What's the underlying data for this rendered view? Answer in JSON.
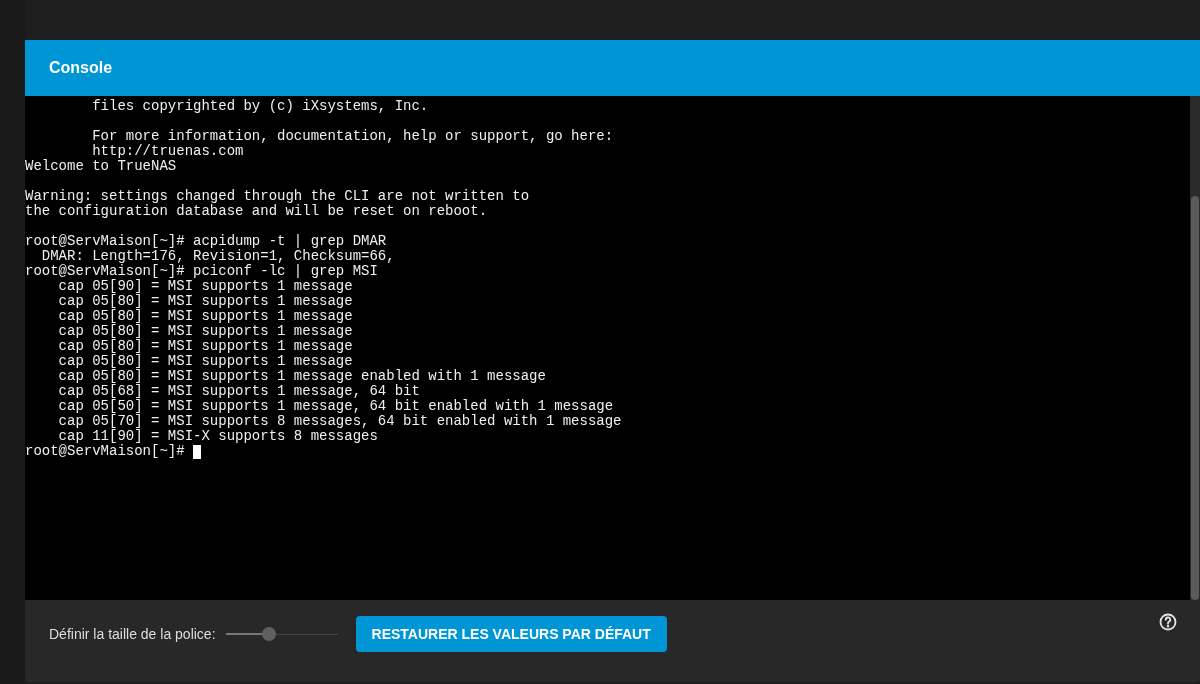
{
  "header": {
    "title": "Console"
  },
  "terminal": {
    "blocks": [
      [
        "        files copyrighted by (c) iXsystems, Inc."
      ],
      [
        "        For more information, documentation, help or support, go here:",
        "        http://truenas.com",
        "Welcome to TrueNAS"
      ],
      [
        "Warning: settings changed through the CLI are not written to",
        "the configuration database and will be reset on reboot."
      ],
      [
        "root@ServMaison[~]# acpidump -t | grep DMAR",
        "  DMAR: Length=176, Revision=1, Checksum=66,",
        "root@ServMaison[~]# pciconf -lc | grep MSI",
        "    cap 05[90] = MSI supports 1 message",
        "    cap 05[80] = MSI supports 1 message",
        "    cap 05[80] = MSI supports 1 message",
        "    cap 05[80] = MSI supports 1 message",
        "    cap 05[80] = MSI supports 1 message",
        "    cap 05[80] = MSI supports 1 message",
        "    cap 05[80] = MSI supports 1 message enabled with 1 message",
        "    cap 05[68] = MSI supports 1 message, 64 bit",
        "    cap 05[50] = MSI supports 1 message, 64 bit enabled with 1 message",
        "    cap 05[70] = MSI supports 8 messages, 64 bit enabled with 1 message",
        "    cap 11[90] = MSI-X supports 8 messages",
        "root@ServMaison[~]# "
      ]
    ],
    "cursor": true
  },
  "footer": {
    "font_size_label": "Définir la taille de la police:",
    "font_size": {
      "level": 0.39
    },
    "reset_button": "RESTAURER LES VALEURS PAR DÉFAUT"
  }
}
